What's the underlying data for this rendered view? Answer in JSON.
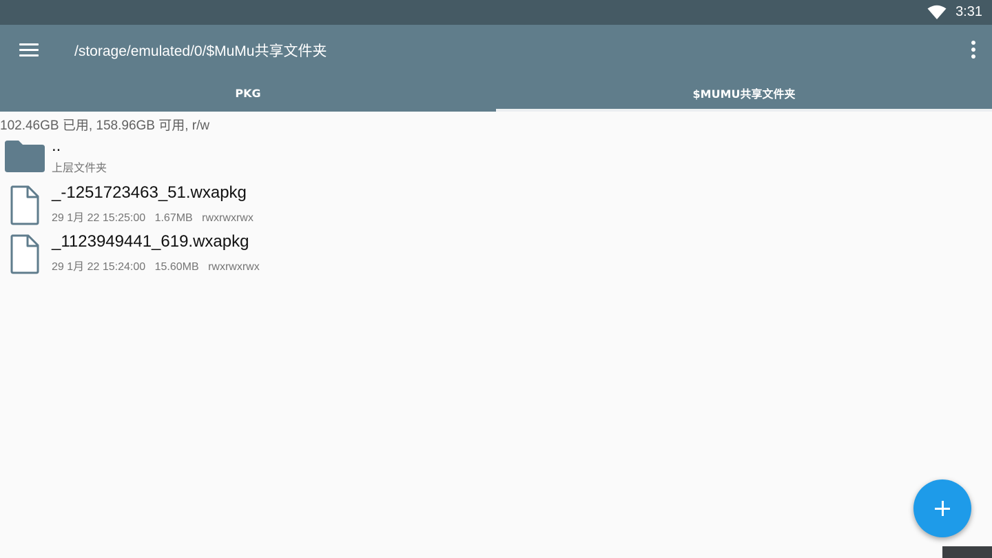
{
  "status_bar": {
    "time": "3:31",
    "wifi_icon": "wifi-icon",
    "background_color": "#455a64"
  },
  "app_bar": {
    "menu_icon": "menu-icon",
    "path_title": "/storage/emulated/0/$MuMu共享文件夹",
    "overflow_icon": "more-vert-icon",
    "background_color": "#607d8b"
  },
  "tabs": [
    {
      "label": "PKG",
      "selected": false
    },
    {
      "label": "$MUMU共享文件夹",
      "selected": true
    }
  ],
  "storage_info": "102.46GB 已用, 158.96GB 可用, r/w",
  "files": [
    {
      "icon": "folder-icon",
      "name": "..",
      "subtitle": "上层文件夹"
    },
    {
      "icon": "file-icon",
      "name": "_-1251723463_51.wxapkg",
      "date": "29 1月 22 15:25:00",
      "size": "1.67MB",
      "permissions": "rwxrwxrwx"
    },
    {
      "icon": "file-icon",
      "name": "_1123949441_619.wxapkg",
      "date": "29 1月 22 15:24:00",
      "size": "15.60MB",
      "permissions": "rwxrwxrwx"
    }
  ],
  "fab": {
    "icon": "plus-icon",
    "color": "#1e9be9"
  }
}
